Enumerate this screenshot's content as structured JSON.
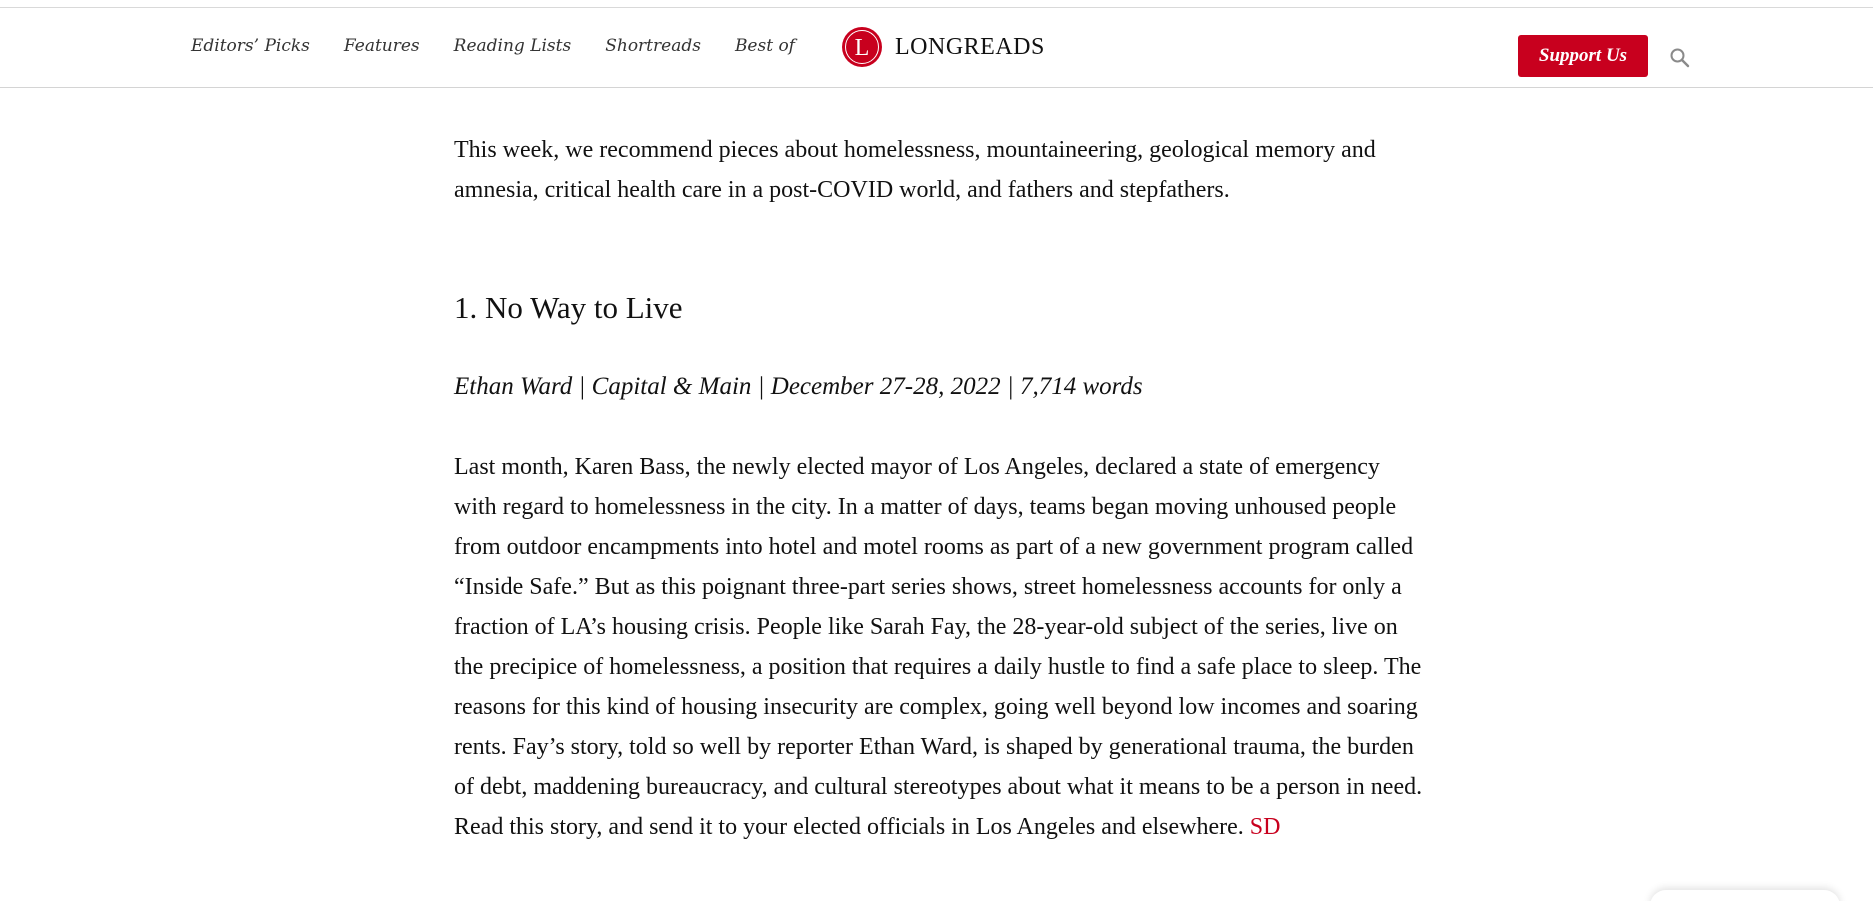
{
  "header": {
    "nav": [
      {
        "label": "Editors’ Picks"
      },
      {
        "label": "Features"
      },
      {
        "label": "Reading Lists"
      },
      {
        "label": "Shortreads"
      },
      {
        "label": "Best of"
      }
    ],
    "logo": {
      "letter": "L",
      "text": "LONGREADS"
    },
    "support_label": "Support Us",
    "search_icon": "search-icon"
  },
  "article": {
    "intro": "This week, we recommend pieces about homelessness, mountaineering, geological memory and amnesia, critical health care in a post-COVID world, and fathers and stepfathers.",
    "headline": "1. No Way to Live",
    "byline": "Ethan Ward | Capital & Main | December 27-28, 2022 | 7,714 words",
    "body": "Last month, Karen Bass, the newly elected mayor of Los Angeles, declared a state of emergency with regard to homelessness in the city. In a matter of days, teams began moving unhoused people from outdoor encampments into hotel and motel rooms as part of a new government program called “Inside Safe.” But as this poignant three-part series shows, street homelessness accounts for only a fraction of LA’s housing crisis. People like Sarah Fay, the 28-year-old subject of the series, live on the precipice of homelessness, a position that requires a daily hustle to find a safe place to sleep. The reasons for this kind of housing insecurity are complex, going well beyond low incomes and soaring rents. Fay’s story, told so well by reporter Ethan Ward, is shaped by generational trauma, the burden of debt, maddening bureaucracy, and cultural stereotypes about what it means to be a person in need. Read this story, and send it to your elected officials in Los Angeles and elsewhere.",
    "body_link": "SD"
  },
  "colors": {
    "brand": "#c8001e",
    "text": "#111111"
  }
}
